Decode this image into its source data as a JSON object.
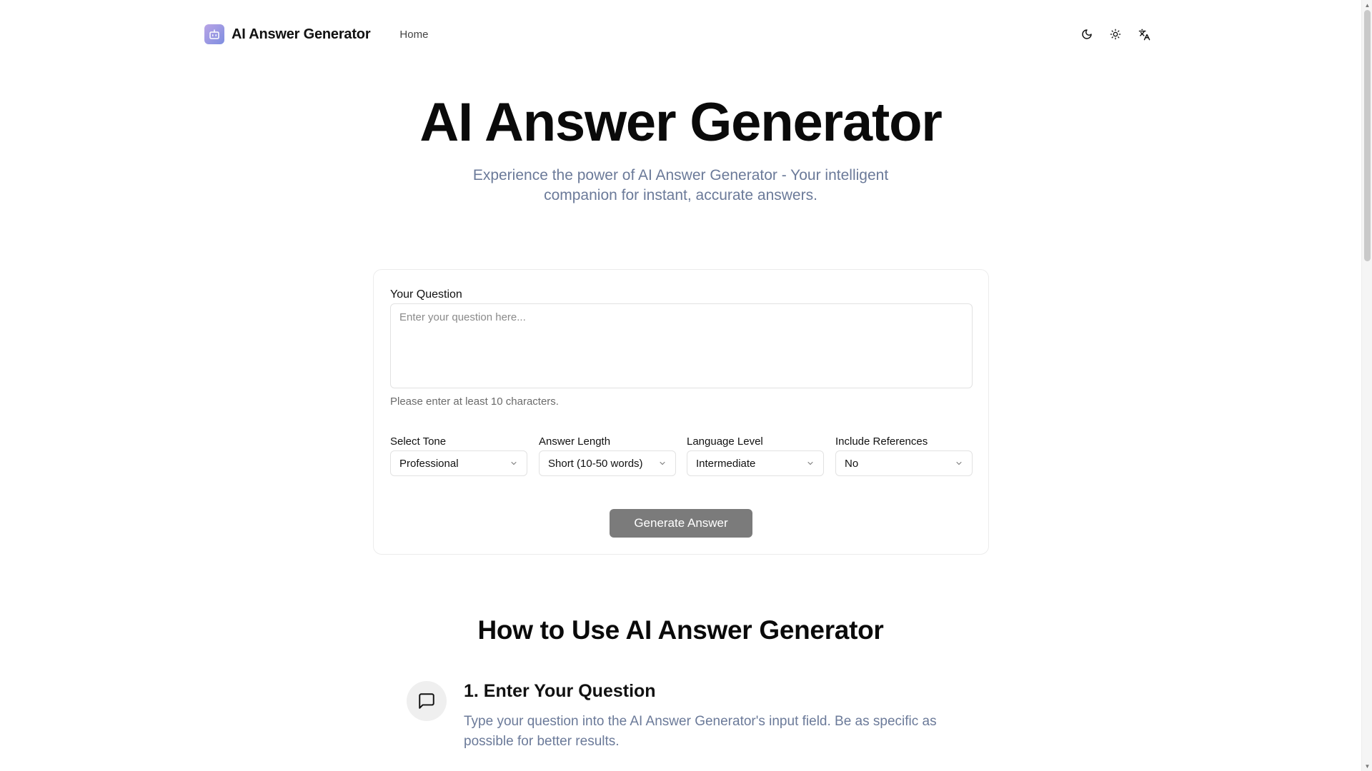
{
  "header": {
    "brand": "AI Answer Generator",
    "nav_home": "Home",
    "icons": [
      "moon-icon",
      "sun-icon",
      "translate-icon"
    ]
  },
  "hero": {
    "title": "AI Answer Generator",
    "subtitle": "Experience the power of AI Answer Generator - Your intelligent companion for instant, accurate answers."
  },
  "form": {
    "question_label": "Your Question",
    "question_placeholder": "Enter your question here...",
    "question_value": "",
    "hint": "Please enter at least 10 characters.",
    "tone": {
      "label": "Select Tone",
      "value": "Professional"
    },
    "length": {
      "label": "Answer Length",
      "value": "Short (10-50 words)"
    },
    "level": {
      "label": "Language Level",
      "value": "Intermediate"
    },
    "references": {
      "label": "Include References",
      "value": "No"
    },
    "submit_label": "Generate Answer"
  },
  "howto": {
    "title": "How to Use AI Answer Generator",
    "steps": [
      {
        "icon": "message-square-icon",
        "title": "1. Enter Your Question",
        "description": "Type your question into the AI Answer Generator's input field. Be as specific as possible for better results."
      }
    ]
  },
  "colors": {
    "accent_text": "#6b7a99",
    "button_bg": "#7b7b7b",
    "logo_gradient_start": "#b9a4e6",
    "logo_gradient_end": "#7e8ee0"
  }
}
